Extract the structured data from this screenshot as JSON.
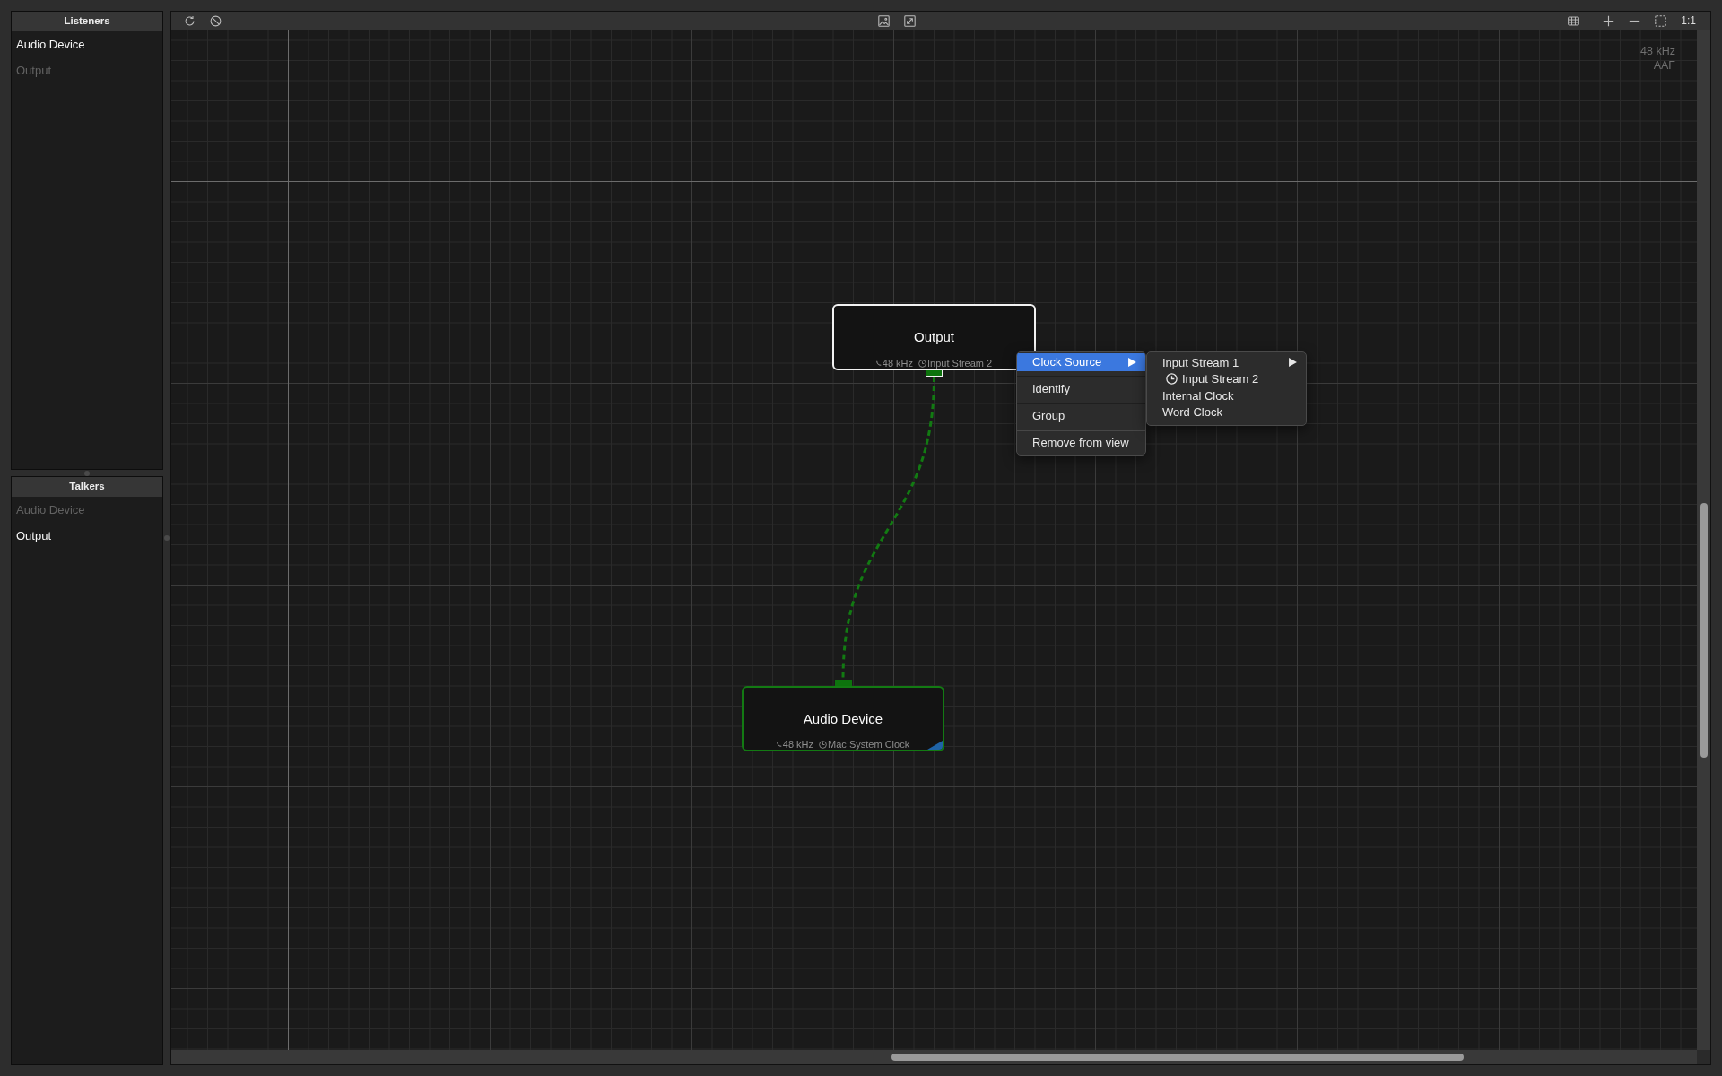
{
  "sidebar": {
    "panels": [
      {
        "title": "Listeners",
        "items": [
          {
            "label": "Audio Device",
            "disabled": false
          },
          {
            "label": "Output",
            "disabled": true
          }
        ]
      },
      {
        "title": "Talkers",
        "items": [
          {
            "label": "Audio Device",
            "disabled": true
          },
          {
            "label": "Output",
            "disabled": false
          }
        ]
      }
    ]
  },
  "toolbar": {
    "zoom_button": "1:1"
  },
  "canvas": {
    "info": [
      "48 kHz",
      "AAF"
    ],
    "nodes": [
      {
        "title": "Output",
        "sample_rate": "48 kHz",
        "clock": "Input Stream 2",
        "selected": true,
        "output_port": true,
        "input_port": false
      },
      {
        "title": "Audio Device",
        "sample_rate": "48 kHz",
        "clock": "Mac System Clock",
        "selected": false,
        "output_port": false,
        "input_port": true,
        "corner_marker": true
      }
    ],
    "context_menu": {
      "items": [
        {
          "label": "Clock Source",
          "selected": true,
          "has_submenu": true
        },
        {
          "label": "Identify",
          "selected": false,
          "has_submenu": false
        },
        {
          "label": "Group",
          "selected": false,
          "has_submenu": false
        },
        {
          "label": "Remove from view",
          "selected": false,
          "has_submenu": false
        }
      ],
      "submenu": {
        "items": [
          {
            "label": "Input Stream 1",
            "checked": false,
            "has_submenu": true
          },
          {
            "label": "Input Stream 2",
            "checked": true,
            "has_submenu": false
          },
          {
            "label": "Internal Clock",
            "checked": false,
            "has_submenu": false
          },
          {
            "label": "Word Clock",
            "checked": false,
            "has_submenu": false
          }
        ]
      }
    }
  }
}
